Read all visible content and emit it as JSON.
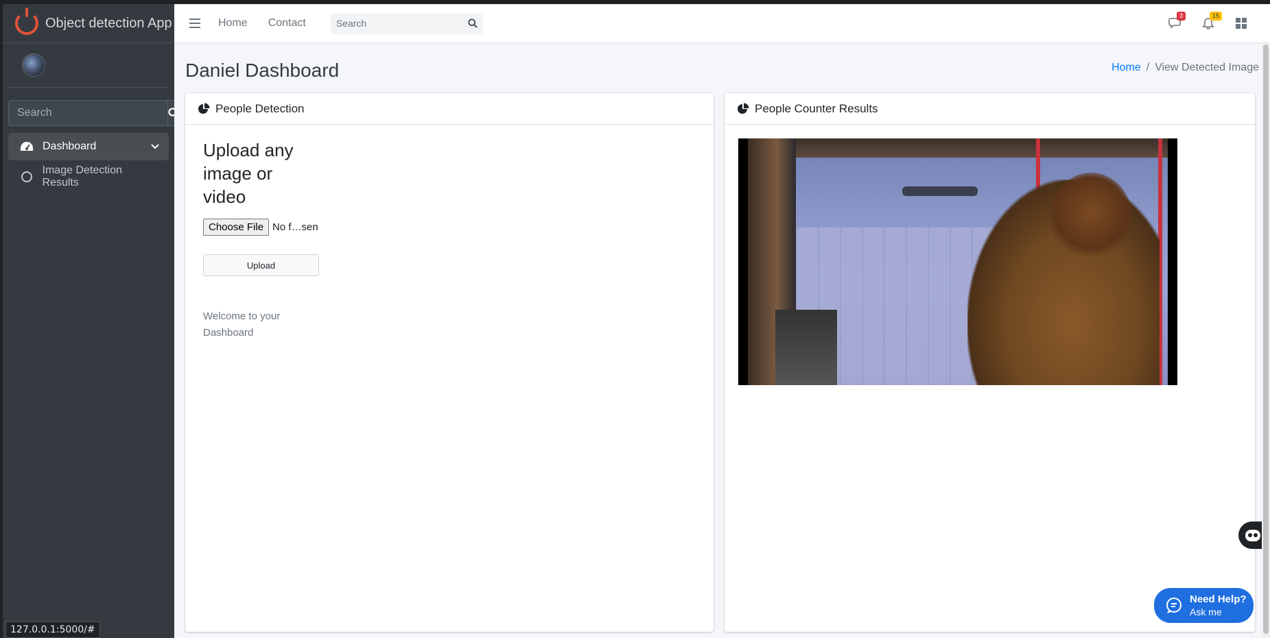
{
  "app": {
    "brand": "Object detection App"
  },
  "sidebar": {
    "search_placeholder": "Search",
    "items": [
      {
        "label": "Dashboard",
        "icon": "tachometer-icon"
      },
      {
        "label": "Image Detection Results",
        "icon": "circle-icon"
      }
    ]
  },
  "status_url": "127.0.0.1:5000/#",
  "navbar": {
    "links": [
      "Home",
      "Contact"
    ],
    "search_placeholder": "Search",
    "messages_count": "3",
    "notifications_count": "15"
  },
  "header": {
    "title": "Daniel Dashboard",
    "breadcrumb_home": "Home",
    "breadcrumb_sep": "/",
    "breadcrumb_current": "View Detected Image"
  },
  "left_card": {
    "title": "People Detection",
    "upload_heading": "Upload any image or video",
    "choose_file_label": "Choose File",
    "file_status": "No f…sen",
    "upload_label": "Upload",
    "welcome": "Welcome to your Dashboard"
  },
  "right_card": {
    "title": "People Counter Results"
  },
  "help": {
    "title": "Need Help?",
    "subtitle": "Ask me"
  },
  "colors": {
    "primary": "#007bff",
    "sidebar_bg": "#343a40",
    "help_bg": "#1f6fe0",
    "brand_logo": "#e0523a"
  }
}
